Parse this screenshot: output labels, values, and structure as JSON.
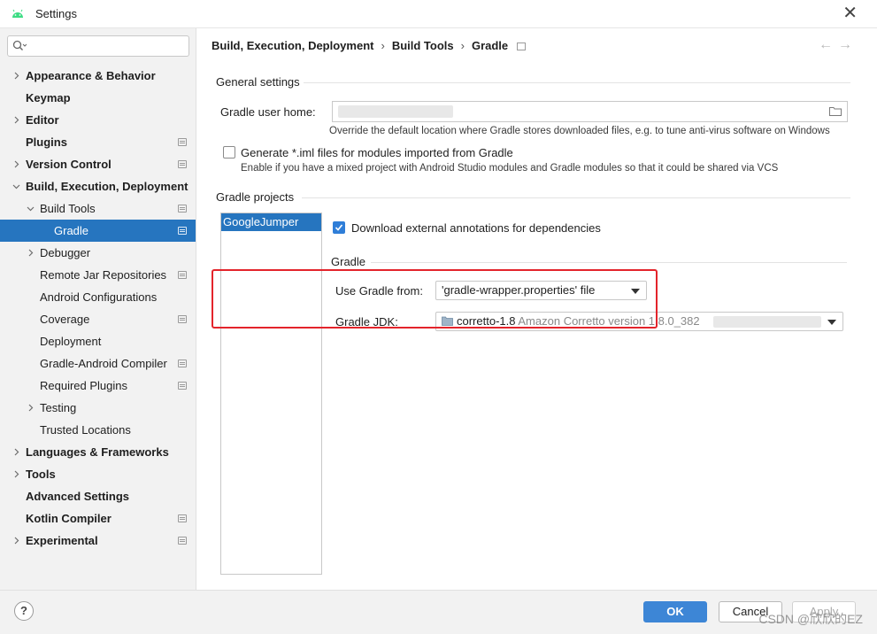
{
  "window": {
    "title": "Settings",
    "close_glyph": "✕"
  },
  "sidebar": {
    "search_placeholder": "",
    "items": [
      {
        "label": "Appearance & Behavior",
        "bold": true,
        "chevron": "right",
        "level": 0
      },
      {
        "label": "Keymap",
        "bold": true,
        "chevron": "none",
        "level": 0
      },
      {
        "label": "Editor",
        "bold": true,
        "chevron": "right",
        "level": 0
      },
      {
        "label": "Plugins",
        "bold": true,
        "chevron": "none",
        "level": 0,
        "project_icon": true
      },
      {
        "label": "Version Control",
        "bold": true,
        "chevron": "right",
        "level": 0,
        "project_icon": true
      },
      {
        "label": "Build, Execution, Deployment",
        "bold": true,
        "chevron": "down",
        "level": 0
      },
      {
        "label": "Build Tools",
        "bold": false,
        "chevron": "down",
        "level": 1,
        "project_icon": true
      },
      {
        "label": "Gradle",
        "bold": false,
        "chevron": "none",
        "level": 2,
        "project_icon": true,
        "selected": true
      },
      {
        "label": "Debugger",
        "bold": false,
        "chevron": "right",
        "level": 1
      },
      {
        "label": "Remote Jar Repositories",
        "bold": false,
        "chevron": "none",
        "level": 1,
        "project_icon": true
      },
      {
        "label": "Android Configurations",
        "bold": false,
        "chevron": "none",
        "level": 1
      },
      {
        "label": "Coverage",
        "bold": false,
        "chevron": "none",
        "level": 1,
        "project_icon": true
      },
      {
        "label": "Deployment",
        "bold": false,
        "chevron": "none",
        "level": 1
      },
      {
        "label": "Gradle-Android Compiler",
        "bold": false,
        "chevron": "none",
        "level": 1,
        "project_icon": true
      },
      {
        "label": "Required Plugins",
        "bold": false,
        "chevron": "none",
        "level": 1,
        "project_icon": true
      },
      {
        "label": "Testing",
        "bold": false,
        "chevron": "right",
        "level": 1
      },
      {
        "label": "Trusted Locations",
        "bold": false,
        "chevron": "none",
        "level": 1
      },
      {
        "label": "Languages & Frameworks",
        "bold": true,
        "chevron": "right",
        "level": 0
      },
      {
        "label": "Tools",
        "bold": true,
        "chevron": "right",
        "level": 0
      },
      {
        "label": "Advanced Settings",
        "bold": true,
        "chevron": "none",
        "level": 0
      },
      {
        "label": "Kotlin Compiler",
        "bold": true,
        "chevron": "none",
        "level": 0,
        "project_icon": true
      },
      {
        "label": "Experimental",
        "bold": true,
        "chevron": "right",
        "level": 0,
        "project_icon": true
      }
    ]
  },
  "breadcrumb": {
    "part1": "Build, Execution, Deployment",
    "part2": "Build Tools",
    "part3": "Gradle",
    "separator": "›"
  },
  "nav": {
    "back": "←",
    "forward": "→"
  },
  "general": {
    "section_title": "General settings",
    "user_home_label": "Gradle user home:",
    "user_home_value": "",
    "user_home_hint": "Override the default location where Gradle stores downloaded files, e.g. to tune anti-virus software on Windows",
    "iml_label": "Generate *.iml files for modules imported from Gradle",
    "iml_checked": false,
    "iml_hint": "Enable if you have a mixed project with Android Studio modules and Gradle modules so that it could be shared via VCS"
  },
  "projects": {
    "section_title": "Gradle projects",
    "list": [
      "GoogleJumper"
    ],
    "download_annotations_label": "Download external annotations for dependencies",
    "download_annotations_checked": true,
    "gradle_section_title": "Gradle",
    "use_gradle_from_label": "Use Gradle from:",
    "use_gradle_from_value": "'gradle-wrapper.properties' file",
    "jdk_label": "Gradle JDK:",
    "jdk_name": "corretto-1.8",
    "jdk_detail": "Amazon Corretto version 1.8.0_382"
  },
  "footer": {
    "help": "?",
    "ok": "OK",
    "cancel": "Cancel",
    "apply": "Apply",
    "watermark": "CSDN @欣欣的EZ"
  },
  "colors": {
    "selection": "#2675bf",
    "accent_button": "#3d86d6",
    "highlight_box": "#e3242b"
  }
}
